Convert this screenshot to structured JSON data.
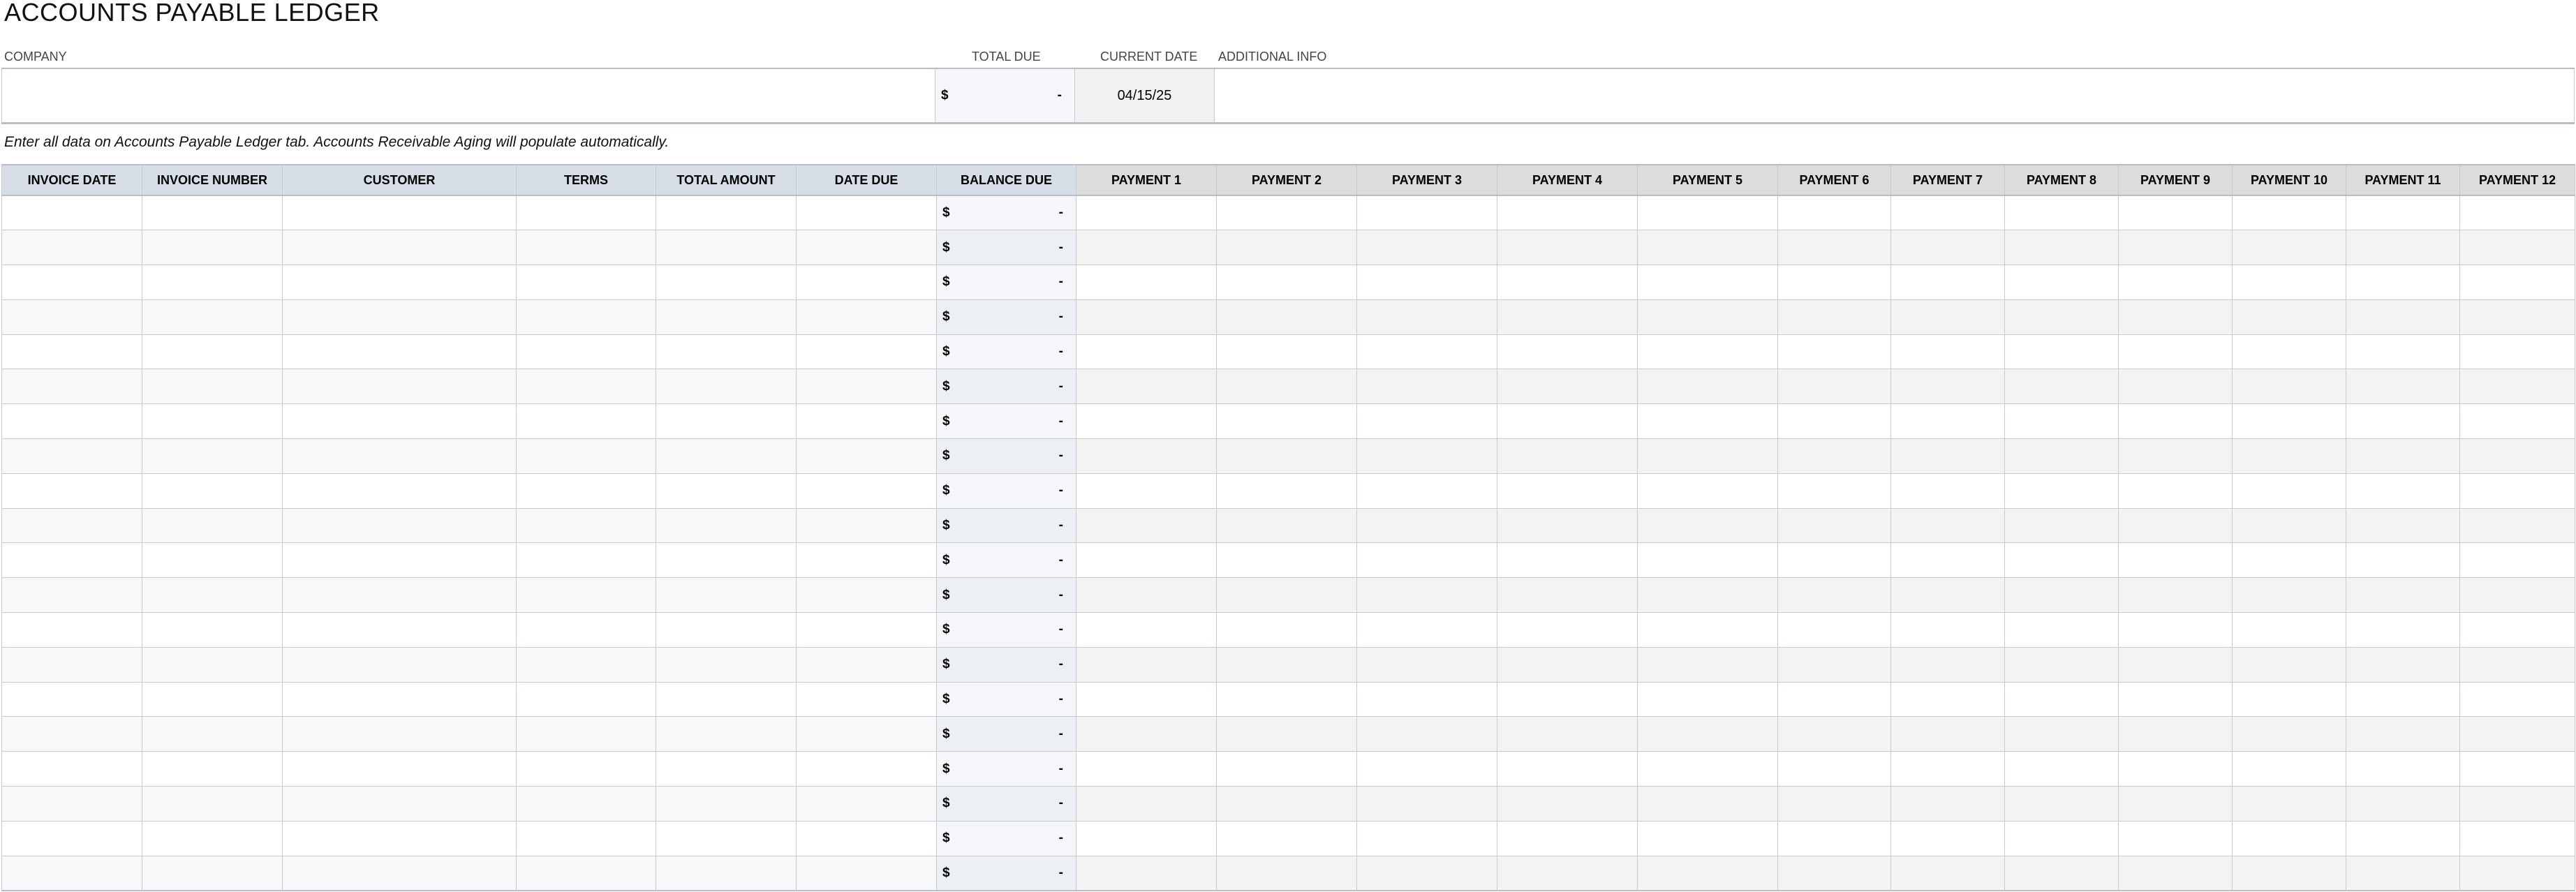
{
  "title": "ACCOUNTS PAYABLE LEDGER",
  "summary": {
    "company_label": "COMPANY",
    "total_due_label": "TOTAL DUE",
    "current_date_label": "CURRENT DATE",
    "additional_info_label": "ADDITIONAL INFO",
    "company_value": "",
    "total_due_currency": "$",
    "total_due_value": "-",
    "current_date_value": "04/15/25",
    "additional_info_value": ""
  },
  "note": "Enter all data on Accounts Payable Ledger tab.  Accounts Receivable Aging will populate automatically.",
  "table": {
    "columns": [
      "INVOICE DATE",
      "INVOICE NUMBER",
      "CUSTOMER",
      "TERMS",
      "TOTAL AMOUNT",
      "DATE DUE",
      "BALANCE DUE",
      "PAYMENT 1",
      "PAYMENT 2",
      "PAYMENT 3",
      "PAYMENT 4",
      "PAYMENT 5",
      "PAYMENT 6",
      "PAYMENT 7",
      "PAYMENT 8",
      "PAYMENT 9",
      "PAYMENT 10",
      "PAYMENT 11",
      "PAYMENT 12"
    ],
    "balance_currency": "$",
    "balance_value": "-",
    "row_count": 20
  }
}
